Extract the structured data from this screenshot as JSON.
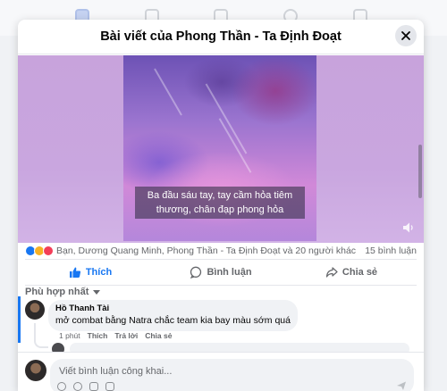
{
  "modal": {
    "title": "Bài viết của Phong Thần - Ta Định Đoạt"
  },
  "video": {
    "caption": "Ba đầu sáu tay, tay cầm hỏa tiêm thương, chân đạp phong hỏa"
  },
  "reactions": {
    "names": "Bạn, Dương Quang Minh, Phong Thần - Ta Định Đoạt và 20 người khác",
    "comment_count": "15 bình luận",
    "icons": [
      "like",
      "haha",
      "love"
    ]
  },
  "actions": {
    "like_label": "Thích",
    "comment_label": "Bình luận",
    "share_label": "Chia sẻ"
  },
  "sort": {
    "label": "Phù hợp nhất"
  },
  "comment": {
    "author": "Hồ Thanh Tài",
    "text": "mở combat bằng Natra chắc team kia bay màu sớm quá",
    "time": "1 phút",
    "like_label": "Thích",
    "reply_label": "Trả lời",
    "share_label": "Chia sẻ"
  },
  "composer": {
    "placeholder": "Viết bình luận công khai..."
  },
  "colors": {
    "accent": "#1877f2",
    "secondary_text": "#65676b",
    "bubble_bg": "#f0f2f5"
  }
}
